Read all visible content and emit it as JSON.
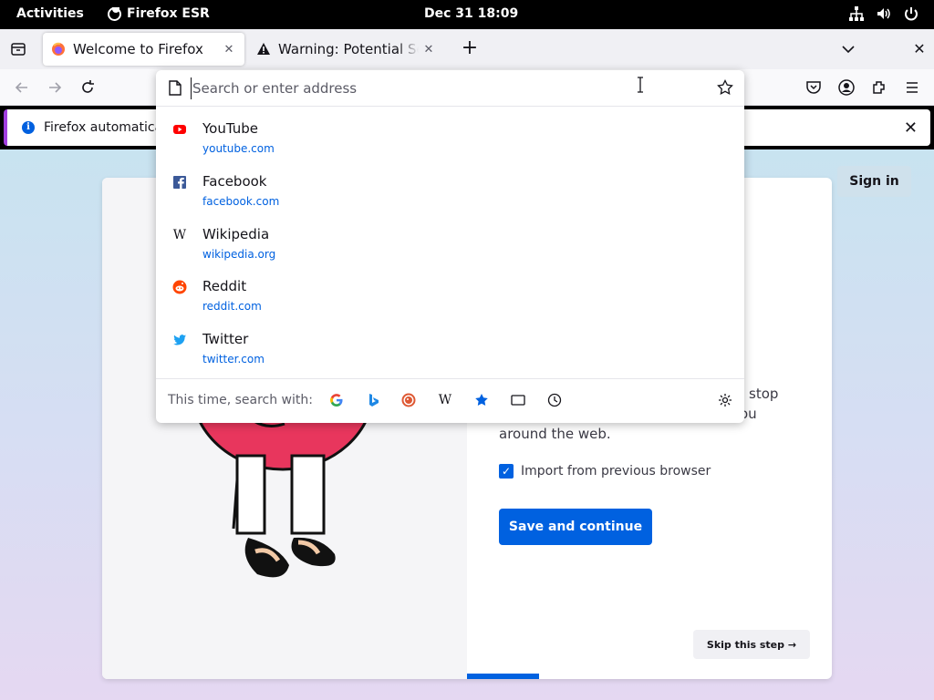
{
  "system": {
    "activities": "Activities",
    "app_name": "Firefox ESR",
    "clock": "Dec 31  18:09"
  },
  "tabs": [
    {
      "title": "Welcome to Firefox",
      "active": true
    },
    {
      "title": "Warning: Potential Security Risk Ahead",
      "active": false
    }
  ],
  "notification": {
    "message": "Firefox automatically"
  },
  "urlbar": {
    "placeholder": "Search or enter address",
    "value": ""
  },
  "suggestions": [
    {
      "name": "YouTube",
      "url": "youtube.com",
      "icon": "youtube-icon",
      "color": "#ff0000"
    },
    {
      "name": "Facebook",
      "url": "facebook.com",
      "icon": "facebook-icon",
      "color": "#3b5998"
    },
    {
      "name": "Wikipedia",
      "url": "wikipedia.org",
      "icon": "wikipedia-icon",
      "color": "#000000"
    },
    {
      "name": "Reddit",
      "url": "reddit.com",
      "icon": "reddit-icon",
      "color": "#ff4500"
    },
    {
      "name": "Twitter",
      "url": "twitter.com",
      "icon": "twitter-icon",
      "color": "#1da1f2"
    }
  ],
  "oneoff": {
    "label": "This time, search with:",
    "engines": [
      "google-icon",
      "bing-icon",
      "duckduckgo-icon",
      "wikipedia-icon",
      "bookmarks-icon",
      "tabs-icon",
      "history-icon"
    ]
  },
  "page": {
    "sign_in": "Sign in",
    "desc_line1": "stop",
    "desc_line2": "ou",
    "desc_line3": "around the web.",
    "import_label": "Import from previous browser",
    "import_checked": true,
    "save_label": "Save and continue",
    "skip_label": "Skip this step →",
    "progress": 0.2
  },
  "colors": {
    "accent": "#0061e0",
    "notification_border": "#a23fe0"
  }
}
